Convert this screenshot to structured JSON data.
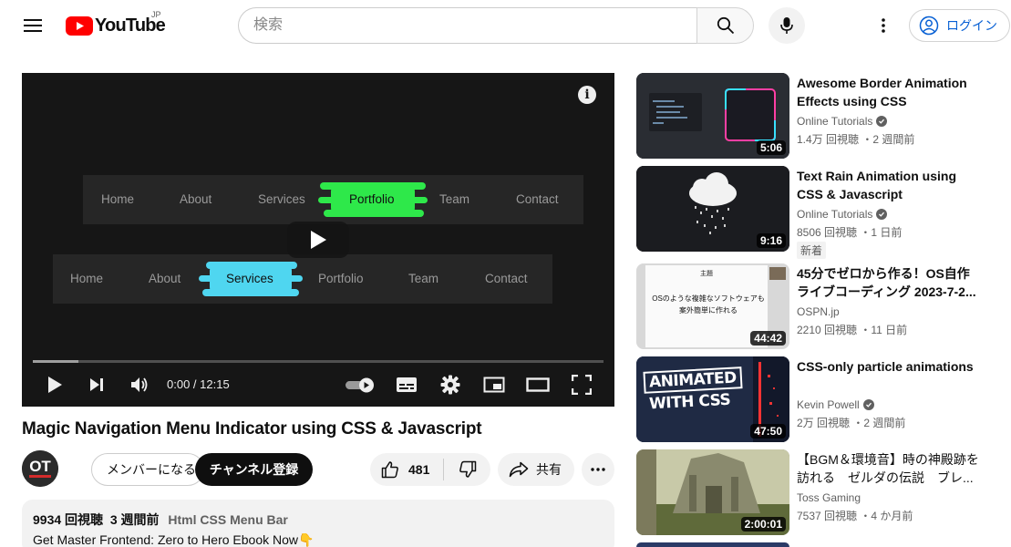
{
  "header": {
    "logo_text": "YouTube",
    "region": "JP",
    "search_placeholder": "検索",
    "signin_label": "ログイン"
  },
  "player": {
    "time": "0:00 / 12:15",
    "progress_buffered_fraction": 0.08,
    "nav_top": {
      "items": [
        "Home",
        "About",
        "Services",
        "Portfolio",
        "Team",
        "Contact"
      ],
      "active_index": 3,
      "active_color": "#2ee84a"
    },
    "nav_bottom": {
      "items": [
        "Home",
        "About",
        "Services",
        "Portfolio",
        "Team",
        "Contact"
      ],
      "active_index": 2,
      "active_color": "#4fd6f0"
    }
  },
  "video": {
    "title": "Magic Navigation Menu Indicator using CSS & Javascript",
    "channel_avatar_text": "OT",
    "member_label": "メンバーになる",
    "subscribe_label": "チャンネル登録",
    "like_count": "481",
    "share_label": "共有",
    "description": {
      "views": "9934 回視聴",
      "date": "3 週間前",
      "tags": "Html CSS Menu Bar",
      "line1": "Get Master Frontend: Zero to Hero Ebook Now👇"
    }
  },
  "sidebar": {
    "items": [
      {
        "title": "Awesome Border Animation Effects using CSS repeating-...",
        "channel": "Online Tutorials",
        "verified": true,
        "stats": "1.4万 回視聴 ・2 週間前",
        "duration": "5:06",
        "badge": ""
      },
      {
        "title": "Text Rain Animation using CSS & Javascript",
        "channel": "Online Tutorials",
        "verified": true,
        "stats": "8506 回視聴 ・1 日前",
        "duration": "9:16",
        "badge": "新着"
      },
      {
        "title": "45分でゼロから作る！OS自作ライブコーディング 2023-7-2...",
        "channel": "OSPN.jp",
        "verified": false,
        "stats": "2210 回視聴 ・11 日前",
        "duration": "44:42",
        "badge": "",
        "thumb_text_1": "主題",
        "thumb_text_2": "OSのような複雑なソフトウェアも\n案外簡単に作れる"
      },
      {
        "title": "CSS-only particle animations",
        "channel": "Kevin Powell",
        "verified": true,
        "stats": "2万 回視聴 ・2 週間前",
        "duration": "47:50",
        "badge": "",
        "thumb_text_1": "ANIMATED",
        "thumb_text_2": "WITH CSS"
      },
      {
        "title": "【BGM＆環境音】時の神殿跡を訪れる　ゼルダの伝説　ブレ...",
        "channel": "Toss Gaming",
        "verified": false,
        "stats": "7537 回視聴 ・4 か月前",
        "duration": "2:00:01",
        "badge": ""
      }
    ]
  }
}
